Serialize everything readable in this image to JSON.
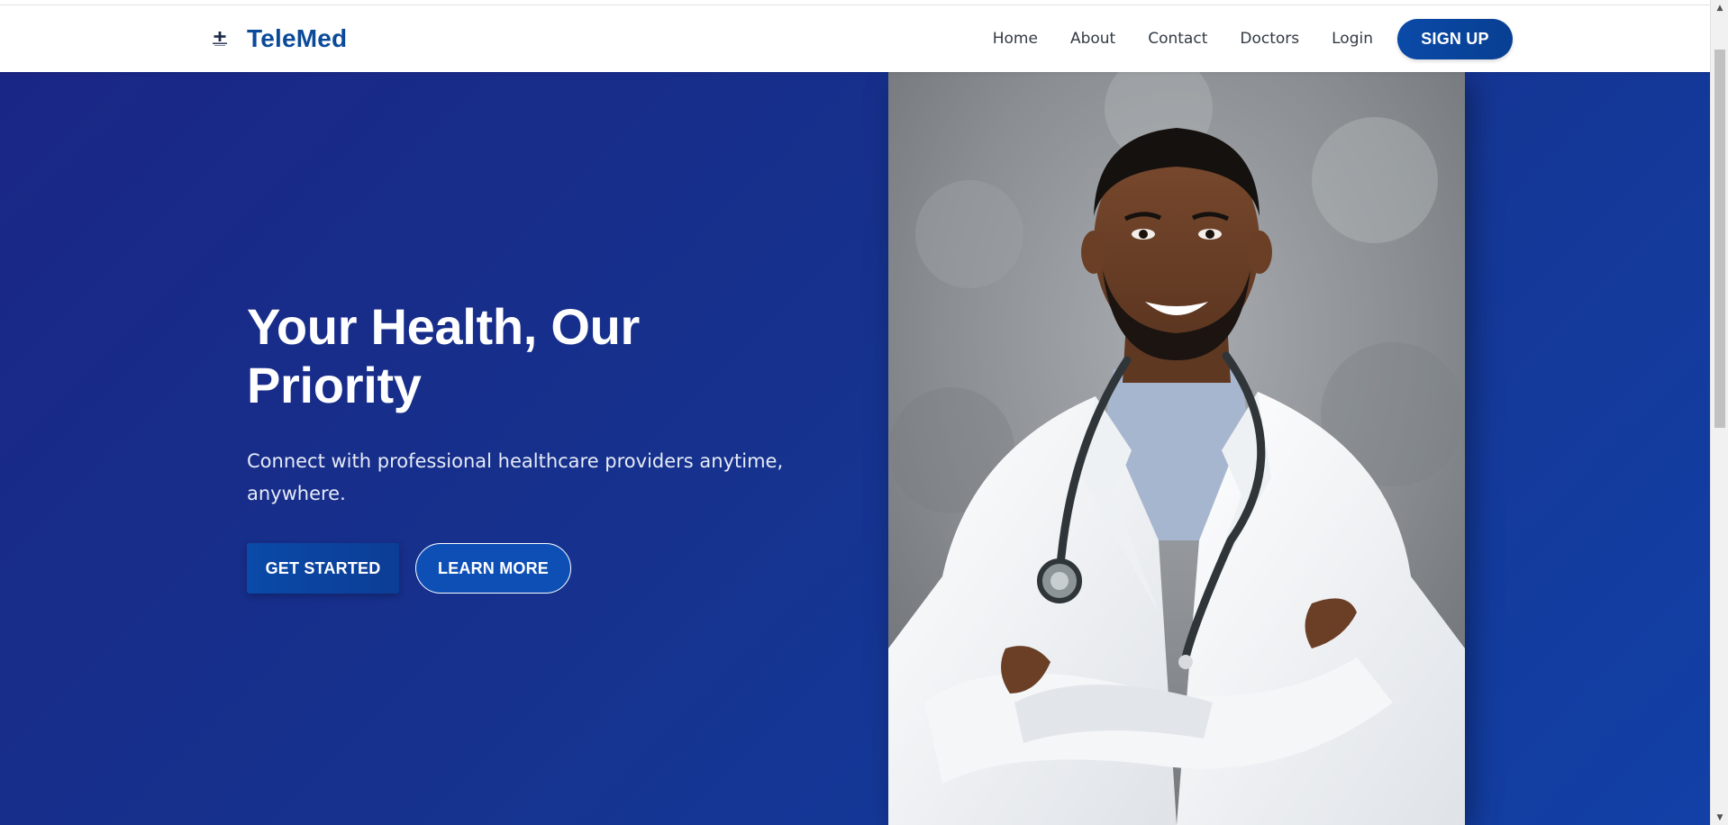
{
  "brand": {
    "name": "TeleMed",
    "logo_icon": "medical-cross-icon",
    "color": "#0b4a99"
  },
  "nav": {
    "links": [
      "Home",
      "About",
      "Contact",
      "Doctors",
      "Login"
    ],
    "signup_label": "SIGN UP"
  },
  "hero": {
    "title": "Your Health, Our Priority",
    "subtitle": "Connect with professional healthcare providers anytime, anywhere.",
    "primary_cta": "GET STARTED",
    "secondary_cta": "LEARN MORE",
    "background_colors": [
      "#1a2685",
      "#1240a6"
    ],
    "image": "doctor-portrait"
  },
  "scrollbar": {
    "up_icon": "scroll-up-arrow-icon",
    "down_icon": "scroll-down-arrow-icon"
  }
}
